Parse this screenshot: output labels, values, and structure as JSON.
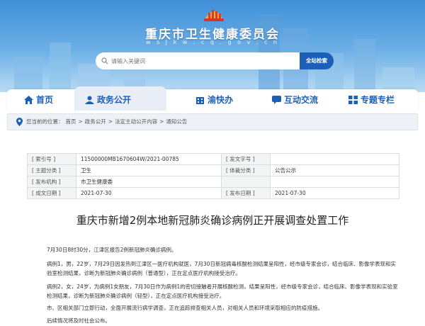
{
  "header": {
    "site_title": "重庆市卫生健康委员会",
    "site_domain": "w s j k w . c q . g o v . c n",
    "search_placeholder": "请输入关键词",
    "search_button": "全站检索"
  },
  "nav": {
    "items": [
      {
        "label": "首页",
        "icon": "home-icon"
      },
      {
        "label": "政务公开",
        "icon": "user-icon"
      },
      {
        "label": "渝快办",
        "icon": "building-icon"
      },
      {
        "label": "互动交流",
        "icon": "chat-icon"
      },
      {
        "label": "专题专栏",
        "icon": "grid-icon"
      }
    ],
    "active": "政务公开",
    "accent": "#1c5fb8"
  },
  "breadcrumb": {
    "prefix": "您当前的位置：",
    "items": [
      "首页",
      "政务公开",
      "法定主动公开内容",
      "通知公告"
    ],
    "separator": ">"
  },
  "info": {
    "rows": [
      [
        "[ 索引号 ]",
        "11500000MB1670604W/2021-00785",
        "[ 发文字号 ]",
        ""
      ],
      [
        "[ 主题分类 ]",
        "卫生",
        "[ 体裁分类 ]",
        "公告公示"
      ],
      [
        "[ 发布机构 ]",
        "市卫生健康委",
        "",
        ""
      ],
      [
        "[ 成文日期 ]",
        "2021-07-30",
        "[ 发布日期 ]",
        "2021-07-30"
      ]
    ]
  },
  "article": {
    "title": "重庆市新增2例本地新冠肺炎确诊病例正开展调查处置工作",
    "paragraphs": [
      "7月30日8时30分，江津区报告2例新冠肺炎确诊病例。",
      "病例1，男，22岁，7月29日因发热到江津区一医疗机构就医，7月30日新冠病毒核酸检测结果呈阳性，经市级专家会诊，结合临床、影像学表现和实验室检测结果，诊断为新冠肺炎确诊病例（普通型），正在定点医疗机构接受治疗。",
      "病例2，女，24岁，为病例1女朋友，7月30日作为病例1的密切接触者开展核酸检测，结果呈阳性，经市级专家会诊，结合临床、影像学表现和实验室检测结果，诊断为新冠肺炎确诊病例（轻型），正在定点医疗机构接受治疗。",
      "市、区相关部门立即行动，全面开展流行病学调查，正在追踪排查相关人员，对相关人员和环境采取相应的防疫措施。",
      "后续情况将及时社会公布。"
    ]
  }
}
